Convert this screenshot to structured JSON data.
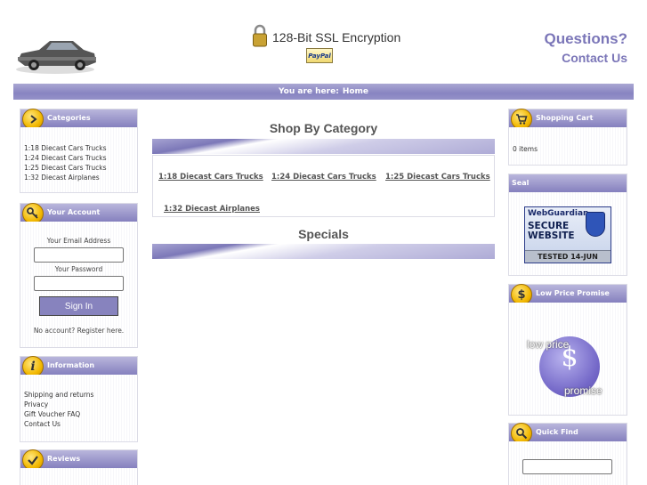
{
  "header": {
    "ssl_text": "128-Bit SSL Encryption",
    "paypal_label": "PayPal",
    "questions": "Questions?",
    "contact_us": "Contact Us"
  },
  "breadcrumb": {
    "prefix": "You are here:",
    "home": "Home"
  },
  "left": {
    "categories": {
      "title": "Categories",
      "items": [
        "1:18 Diecast Cars Trucks",
        "1:24 Diecast Cars Trucks",
        "1:25 Diecast Cars Trucks",
        "1:32 Diecast Airplanes"
      ]
    },
    "account": {
      "title": "Your Account",
      "email_label": "Your Email Address",
      "password_label": "Your Password",
      "signin_label": "Sign In",
      "register_text": "No account? Register here."
    },
    "information": {
      "title": "Information",
      "items": [
        "Shipping and returns",
        "Privacy",
        "Gift Voucher FAQ",
        "Contact Us"
      ]
    },
    "reviews": {
      "title": "Reviews"
    }
  },
  "center": {
    "shop_title": "Shop By Category",
    "category_links": [
      "1:18 Diecast Cars Trucks",
      "1:24 Diecast Cars Trucks",
      "1:25 Diecast Cars Trucks",
      "1:32 Diecast Airplanes"
    ],
    "specials_title": "Specials"
  },
  "right": {
    "cart": {
      "title": "Shopping Cart",
      "items_text": "0 items"
    },
    "seal": {
      "title": "Seal",
      "brand": "WebGuardian",
      "line1": "SECURE",
      "line2": "WEBSITE",
      "tested": "TESTED 14-JUN"
    },
    "lowprice": {
      "title": "Low Price Promise",
      "word1": "low price",
      "symbol": "$",
      "word2": "promise"
    },
    "quickfind": {
      "title": "Quick Find"
    }
  },
  "colors": {
    "accent": "#8884c1",
    "link": "#7b76b8"
  }
}
